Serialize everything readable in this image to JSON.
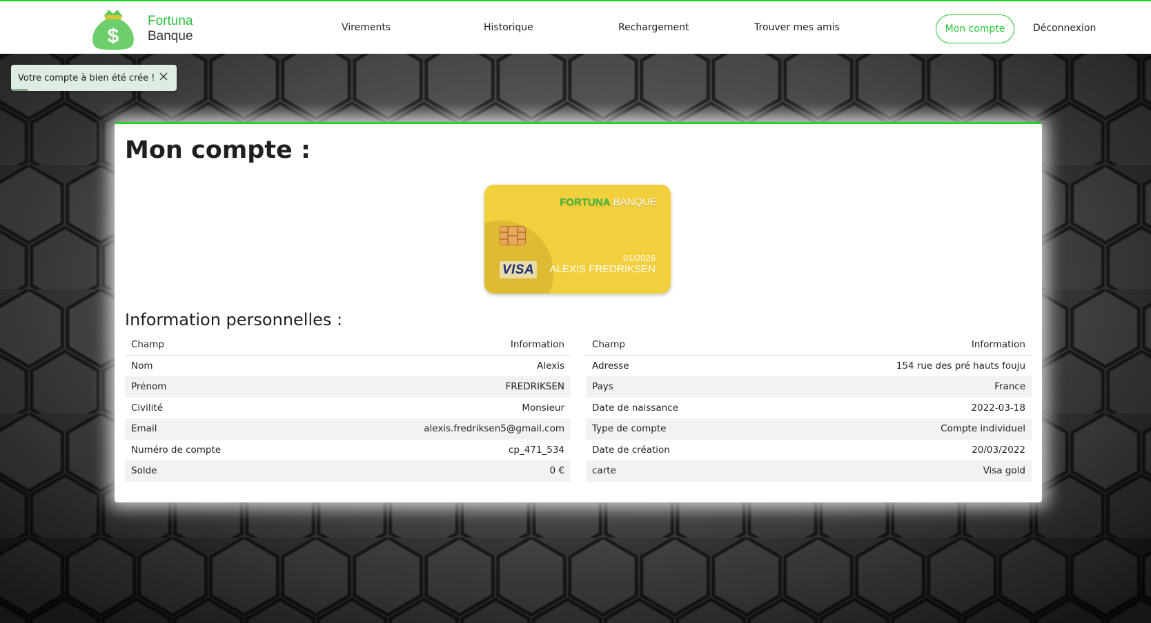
{
  "brand": {
    "line1": "Fortuna",
    "line2": "Banque",
    "logo_icon": "money-bag-icon",
    "accent_color": "#22d32a"
  },
  "nav": {
    "items": [
      {
        "label": "Virements"
      },
      {
        "label": "Historique"
      },
      {
        "label": "Rechargement"
      },
      {
        "label": "Trouver mes amis"
      }
    ],
    "account_label": "Mon compte",
    "logout_label": "Déconnexion"
  },
  "toast": {
    "message": "Votre compte à bien été crée !",
    "close_icon": "close-icon"
  },
  "page": {
    "title": "Mon compte :",
    "section_title": "Information personnelles :"
  },
  "card": {
    "brand_part1": "FORTUNA",
    "brand_part2": "BANQUE",
    "expiry": "01/2026",
    "holder": "ALEXIS FREDRIKSEN",
    "network": "VISA",
    "color": "#f2cf3c"
  },
  "table_left": {
    "headers": [
      "Champ",
      "Information"
    ],
    "rows": [
      [
        "Nom",
        "Alexis"
      ],
      [
        "Prénom",
        "FREDRIKSEN"
      ],
      [
        "Civilité",
        "Monsieur"
      ],
      [
        "Email",
        "alexis.fredriksen5@gmail.com"
      ],
      [
        "Numéro de compte",
        "cp_471_534"
      ],
      [
        "Solde",
        "0 €"
      ]
    ]
  },
  "table_right": {
    "headers": [
      "Champ",
      "Information"
    ],
    "rows": [
      [
        "Adresse",
        "154 rue des pré hauts fouju"
      ],
      [
        "Pays",
        "France"
      ],
      [
        "Date de naissance",
        "2022-03-18"
      ],
      [
        "Type de compte",
        "Compte individuel"
      ],
      [
        "Date de création",
        "20/03/2022"
      ],
      [
        "carte",
        "Visa gold"
      ]
    ]
  }
}
